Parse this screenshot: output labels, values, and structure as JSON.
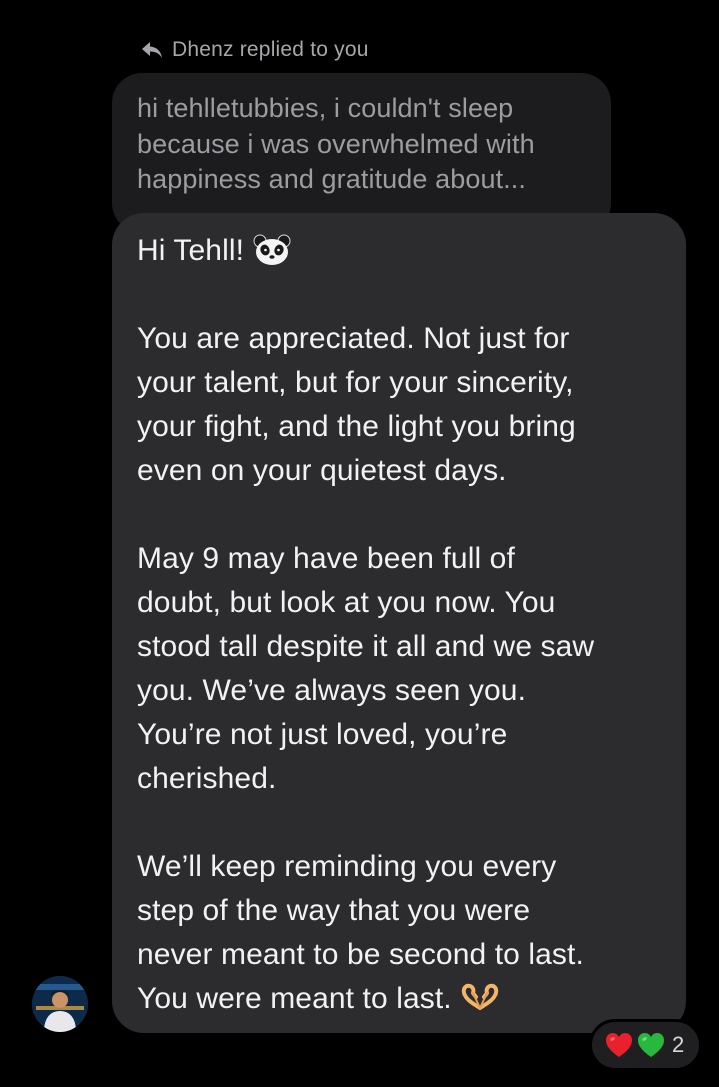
{
  "reply_header": {
    "icon": "reply-arrow-icon",
    "text": "Dhenz replied to you"
  },
  "quoted_message": {
    "text": "hi tehlletubbies, i couldn't sleep\nbecause i was overwhelmed with\nhappiness and gratitude about..."
  },
  "message": {
    "greeting": "Hi Tehll!",
    "greeting_emoji": "🐼",
    "paragraph_1": "You are appreciated. Not just for\nyour talent, but for your sincerity,\nyour fight, and the light you bring\neven on your quietest days.",
    "paragraph_2": "May 9 may have been full of\ndoubt, but look at you now. You\nstood tall despite it all and we saw\nyou. We’ve always seen you.\nYou’re not just loved, you’re\ncherished.",
    "paragraph_3": "We’ll keep reminding you every\nstep of the way that you were\nnever meant to be second to last.\nYou were meant to last.",
    "closing_emoji": "🫶"
  },
  "reactions": {
    "items": [
      "red-heart-icon",
      "green-heart-icon"
    ],
    "count": "2"
  },
  "colors": {
    "background": "#000000",
    "quoted_bubble": "#1c1c1e",
    "message_bubble": "#2c2c2e",
    "heart_red": "#e8212d",
    "heart_green": "#27b83d"
  }
}
